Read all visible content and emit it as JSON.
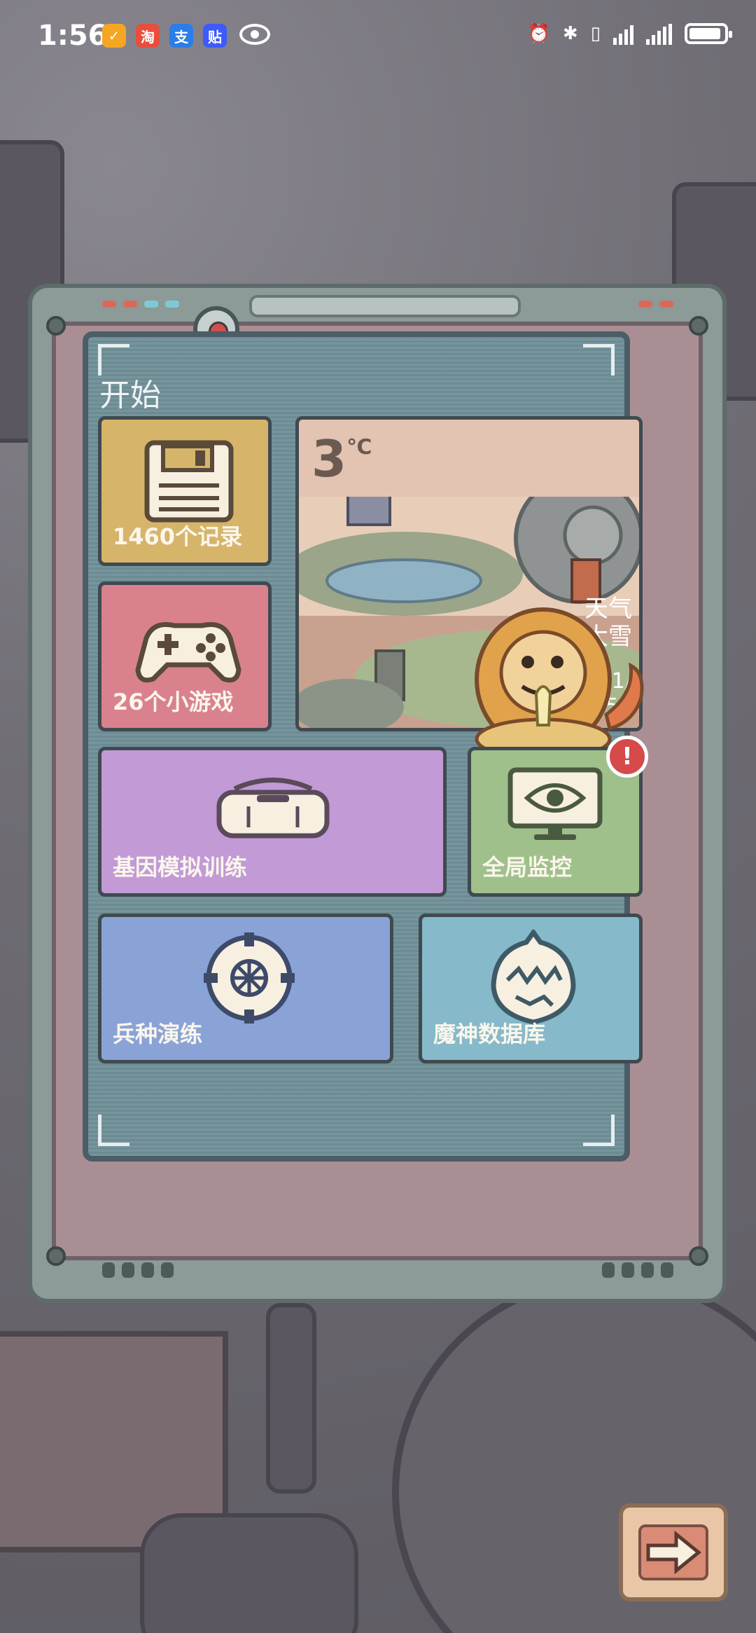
{
  "status_bar": {
    "time": "1:56",
    "app_icons": [
      {
        "name": "app-orange-icon",
        "glyph": "✓",
        "color": "#f5a623"
      },
      {
        "name": "taobao-icon",
        "glyph": "淘",
        "color": "#e94e3c"
      },
      {
        "name": "alipay-icon",
        "glyph": "支",
        "color": "#2b7de9"
      },
      {
        "name": "tieba-icon",
        "glyph": "贴",
        "color": "#3d5afe"
      }
    ]
  },
  "screen": {
    "title": "开始",
    "tiles": {
      "records": {
        "label": "1460个记录",
        "icon": "floppy-disk-icon"
      },
      "games": {
        "label": "26个小游戏",
        "icon": "gamepad-icon"
      },
      "weather": {
        "temp": "3",
        "unit": "℃",
        "weather_line1": "天气",
        "weather_line2": "大雪",
        "date_line1": "1/",
        "date_line2": ":56"
      },
      "gene_training": {
        "label": "基因模拟训练",
        "icon": "vr-headset-icon"
      },
      "monitor": {
        "label": "全局监控",
        "icon": "monitor-eye-icon",
        "badge": "!"
      },
      "troops": {
        "label": "兵种演练",
        "icon": "shield-wheel-icon"
      },
      "demon_db": {
        "label": "魔神数据库",
        "icon": "demon-head-icon"
      }
    }
  },
  "colors": {
    "records": "#d6b56a",
    "games": "#d9828e",
    "gene_training": "#c29ad6",
    "monitor": "#9fc08b",
    "troops": "#8aa3d6",
    "demon_db": "#86b9c9",
    "badge": "#d64a4a"
  },
  "next_button": {
    "icon": "arrow-right-icon"
  }
}
